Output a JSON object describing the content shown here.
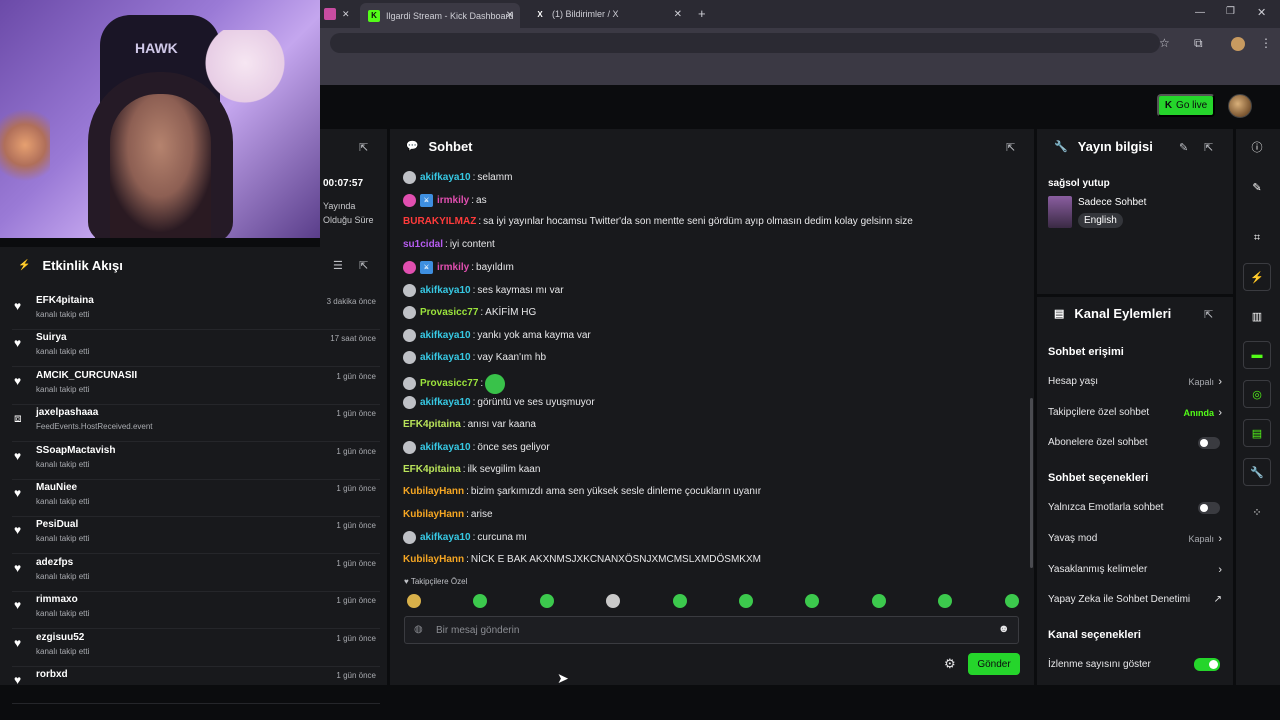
{
  "browser": {
    "tabs": [
      {
        "label": "Ilgardi Stream - Kick Dashboard"
      },
      {
        "label": "(1) Bildirimler / X"
      }
    ],
    "new_tab": "+"
  },
  "topbar": {
    "go_live": "Go live"
  },
  "stream": {
    "time": "00:07:57",
    "time_label": "Yayında Olduğu Süre"
  },
  "activity": {
    "title": "Etkinlik Akışı",
    "items": [
      {
        "name": "EFK4pitaina",
        "sub": "kanalı takip etti",
        "time": "3 dakika önce",
        "icon": "heart"
      },
      {
        "name": "Suirya",
        "sub": "kanalı takip etti",
        "time": "17 saat önce",
        "icon": "heart"
      },
      {
        "name": "AMCIK_CURCUNASII",
        "sub": "kanalı takip etti",
        "time": "1 gün önce",
        "icon": "heart"
      },
      {
        "name": "jaxelpashaaa",
        "sub": "FeedEvents.HostReceived.event",
        "time": "1 gün önce",
        "icon": "host"
      },
      {
        "name": "SSoapMactavish",
        "sub": "kanalı takip etti",
        "time": "1 gün önce",
        "icon": "heart"
      },
      {
        "name": "MauNiee",
        "sub": "kanalı takip etti",
        "time": "1 gün önce",
        "icon": "heart"
      },
      {
        "name": "PesiDual",
        "sub": "kanalı takip etti",
        "time": "1 gün önce",
        "icon": "heart"
      },
      {
        "name": "adezfps",
        "sub": "kanalı takip etti",
        "time": "1 gün önce",
        "icon": "heart"
      },
      {
        "name": "rimmaxo",
        "sub": "kanalı takip etti",
        "time": "1 gün önce",
        "icon": "heart"
      },
      {
        "name": "ezgisuu52",
        "sub": "kanalı takip etti",
        "time": "1 gün önce",
        "icon": "heart"
      },
      {
        "name": "rorbxd",
        "sub": "",
        "time": "1 gün önce",
        "icon": "heart"
      }
    ]
  },
  "chat": {
    "title": "Sohbet",
    "messages": [
      {
        "user": "akifkaya10",
        "text": "selamm",
        "color": "#37c9e4",
        "badges": [
          "grey"
        ]
      },
      {
        "user": "irmkily",
        "text": "as",
        "color": "#e14fb0",
        "badges": [
          "pink",
          "blue"
        ]
      },
      {
        "user": "BURAKYILMAZ",
        "text": "sa iyi yayınlar hocamsu Twitter'da son mentte seni gördüm ayıp olmasın dedim kolay gelsinn size",
        "color": "#ff3b3b",
        "badges": []
      },
      {
        "user": "su1cidal",
        "text": "iyi content",
        "color": "#b65cf0",
        "badges": []
      },
      {
        "user": "irmkily",
        "text": "bayıldım",
        "color": "#e14fb0",
        "badges": [
          "pink",
          "blue"
        ]
      },
      {
        "user": "akifkaya10",
        "text": "ses kayması mı var",
        "color": "#37c9e4",
        "badges": [
          "grey"
        ]
      },
      {
        "user": "Provasicc77",
        "text": "AKİFİM HG",
        "color": "#9be33c",
        "badges": [
          "grey"
        ]
      },
      {
        "user": "akifkaya10",
        "text": "yankı yok ama kayma var",
        "color": "#37c9e4",
        "badges": [
          "grey"
        ]
      },
      {
        "user": "akifkaya10",
        "text": "vay Kaan'ım hb",
        "color": "#37c9e4",
        "badges": [
          "grey"
        ]
      },
      {
        "user": "Provasicc77",
        "text": "",
        "color": "#9be33c",
        "badges": [
          "grey"
        ],
        "emote": true
      },
      {
        "user": "akifkaya10",
        "text": "görüntü ve ses uyuşmuyor",
        "color": "#37c9e4",
        "badges": [
          "grey"
        ]
      },
      {
        "user": "EFK4pitaina",
        "text": "anısı var kaana",
        "color": "#b9e35a",
        "badges": []
      },
      {
        "user": "akifkaya10",
        "text": "önce ses geliyor",
        "color": "#37c9e4",
        "badges": [
          "grey"
        ]
      },
      {
        "user": "EFK4pitaina",
        "text": "ilk sevgilim kaan",
        "color": "#b9e35a",
        "badges": []
      },
      {
        "user": "KubilayHann",
        "text": "bizim şarkımızdı ama sen yüksek sesle dinleme çocukların uyanır",
        "color": "#f5a623",
        "badges": []
      },
      {
        "user": "KubilayHann",
        "text": "arise",
        "color": "#f5a623",
        "badges": []
      },
      {
        "user": "akifkaya10",
        "text": "curcuna mı",
        "color": "#37c9e4",
        "badges": [
          "grey"
        ]
      },
      {
        "user": "KubilayHann",
        "text": "NİCK E BAK AKXNMSJXKCNANXÖSNJXMCMSLXMDÖSMKXM",
        "color": "#f5a623",
        "badges": []
      }
    ],
    "followers_only_label": "Takipçilere Özel",
    "input_placeholder": "Bir mesaj gönderin",
    "send_label": "Gönder"
  },
  "info": {
    "title": "Yayın bilgisi",
    "stream_title": "sağsol yutup",
    "category": "Sadece Sohbet",
    "language": "English"
  },
  "actions": {
    "title": "Kanal Eylemleri",
    "chat_access_title": "Sohbet erişimi",
    "account_age": {
      "label": "Hesap yaşı",
      "value": "Kapalı"
    },
    "followers_only": {
      "label": "Takipçilere özel sohbet",
      "value": "Anında"
    },
    "subscribers_only": {
      "label": "Abonelere özel sohbet"
    },
    "chat_options_title": "Sohbet seçenekleri",
    "emote_only": {
      "label": "Yalnızca Emotlarla sohbet"
    },
    "slow_mode": {
      "label": "Yavaş mod",
      "value": "Kapalı"
    },
    "banned_words": {
      "label": "Yasaklanmış kelimeler"
    },
    "ai_moderation": {
      "label": "Yapay Zeka ile Sohbet Denetimi"
    },
    "channel_options_title": "Kanal seçenekleri",
    "show_viewers": {
      "label": "İzlenme sayısını göster"
    }
  },
  "colors": {
    "accent": "#53fc18",
    "button": "#25d52b",
    "panel": "#18191c",
    "bg": "#0b0c0e"
  },
  "webcam": {
    "chair_logo": "HAWK"
  }
}
